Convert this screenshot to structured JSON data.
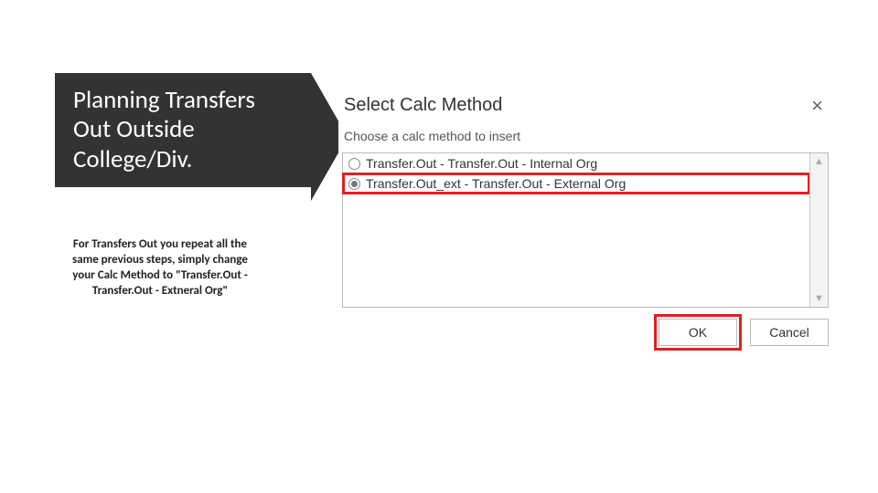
{
  "slide": {
    "title": "Planning Transfers Out Outside College/Div.",
    "subtext": "For Transfers Out you repeat all the same previous steps, simply change your Calc Method to \"Transfer.Out - Transfer.Out - Extneral Org\""
  },
  "dialog": {
    "title": "Select Calc Method",
    "close_label": "×",
    "instruction": "Choose a calc method to insert",
    "options": {
      "opt0": {
        "label": "Transfer.Out - Transfer.Out - Internal Org",
        "selected": false
      },
      "opt1": {
        "label": "Transfer.Out_ext - Transfer.Out - External Org",
        "selected": true
      }
    },
    "scroll": {
      "up": "▲",
      "down": "▼"
    },
    "buttons": {
      "ok": "OK",
      "cancel": "Cancel"
    }
  }
}
